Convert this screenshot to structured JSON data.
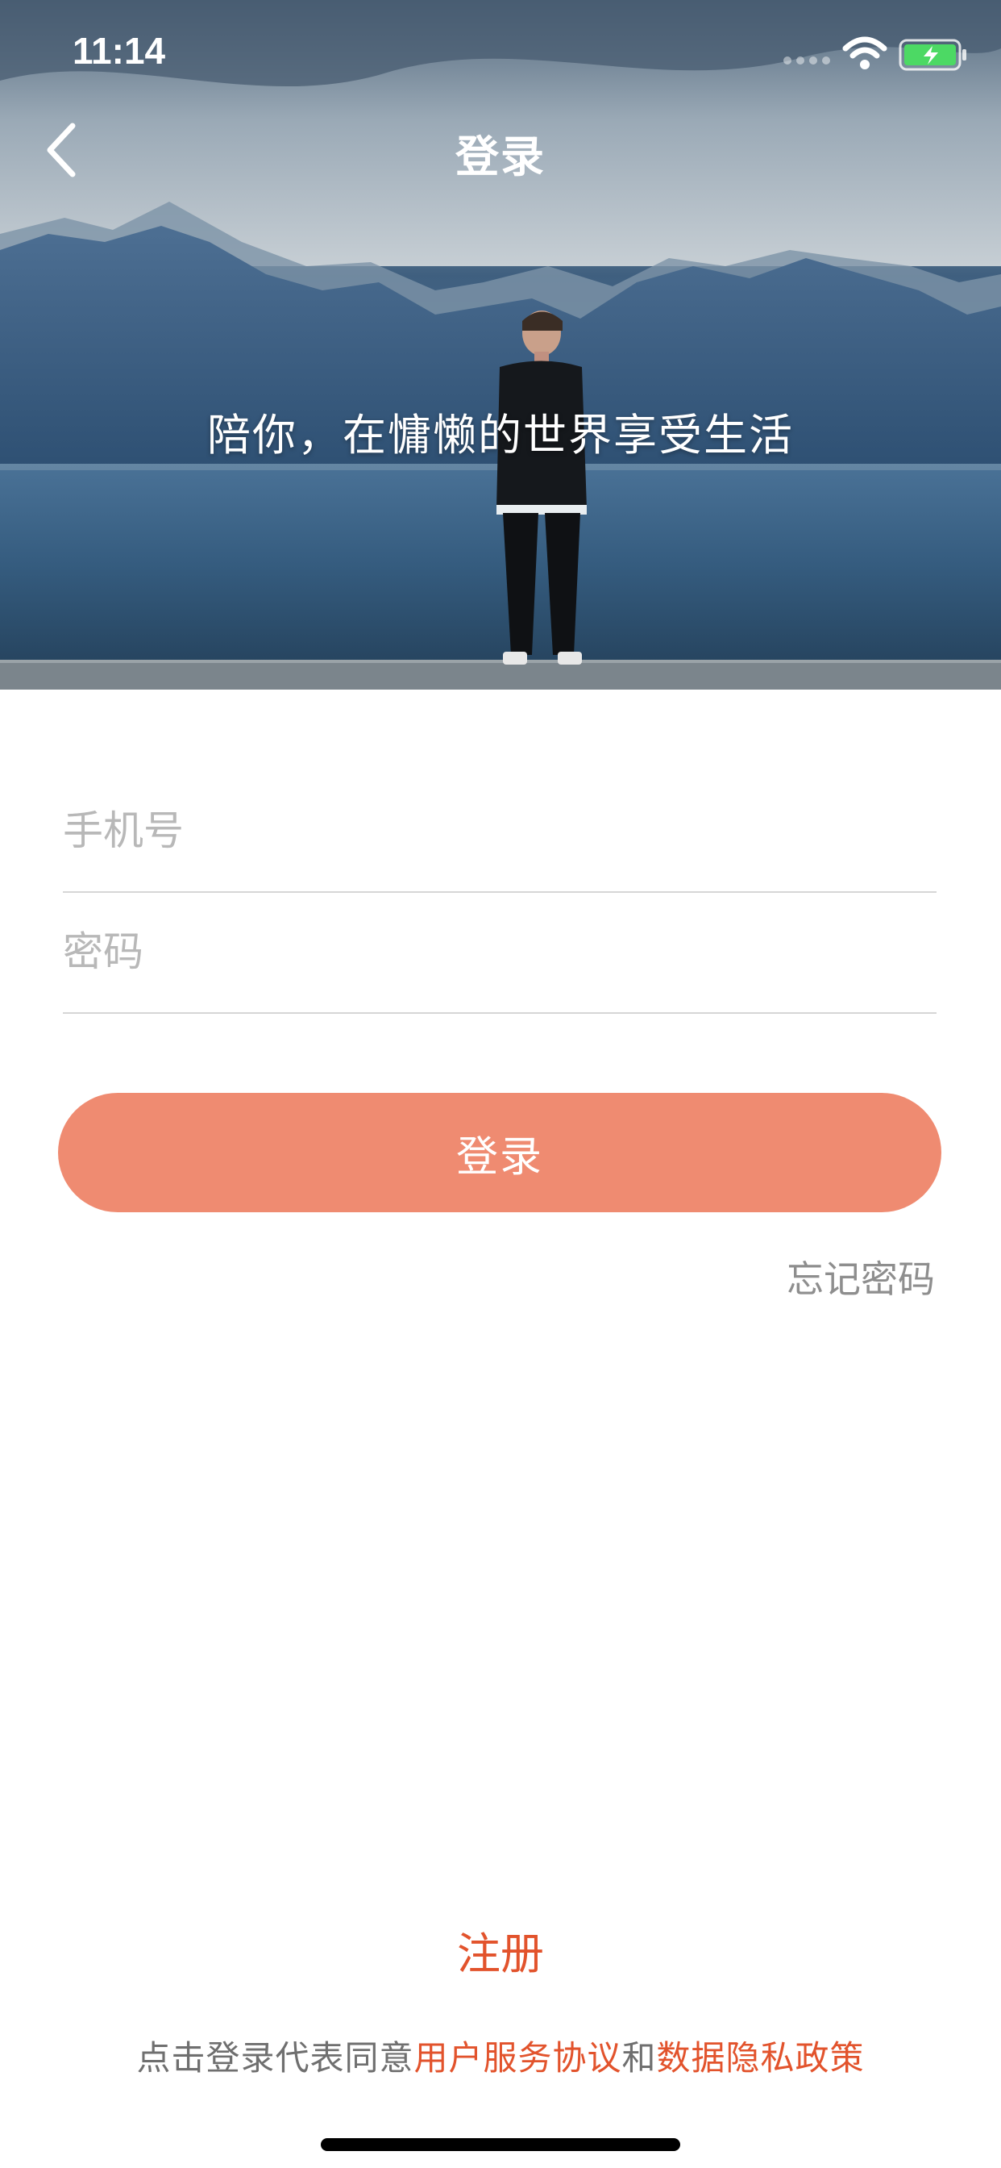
{
  "status_bar": {
    "time": "11:14",
    "icons": [
      "signal-dots-icon",
      "wifi-icon",
      "battery-charging-icon"
    ],
    "battery_color": "#4cd964"
  },
  "nav": {
    "title": "登录",
    "back_icon": "chevron-left-icon"
  },
  "hero": {
    "slogan": "陪你，在慵懒的世界享受生活"
  },
  "form": {
    "phone_placeholder": "手机号",
    "phone_value": "",
    "password_placeholder": "密码",
    "password_value": "",
    "login_label": "登录",
    "forgot_label": "忘记密码"
  },
  "footer": {
    "register_label": "注册",
    "agreement_prefix": "点击登录代表同意",
    "terms_label": "用户服务协议",
    "agreement_and": "和",
    "privacy_label": "数据隐私政策"
  },
  "colors": {
    "accent": "#ef8b71",
    "link": "#e2532c",
    "placeholder": "#b8b8b8",
    "divider": "#d6d6d6"
  }
}
